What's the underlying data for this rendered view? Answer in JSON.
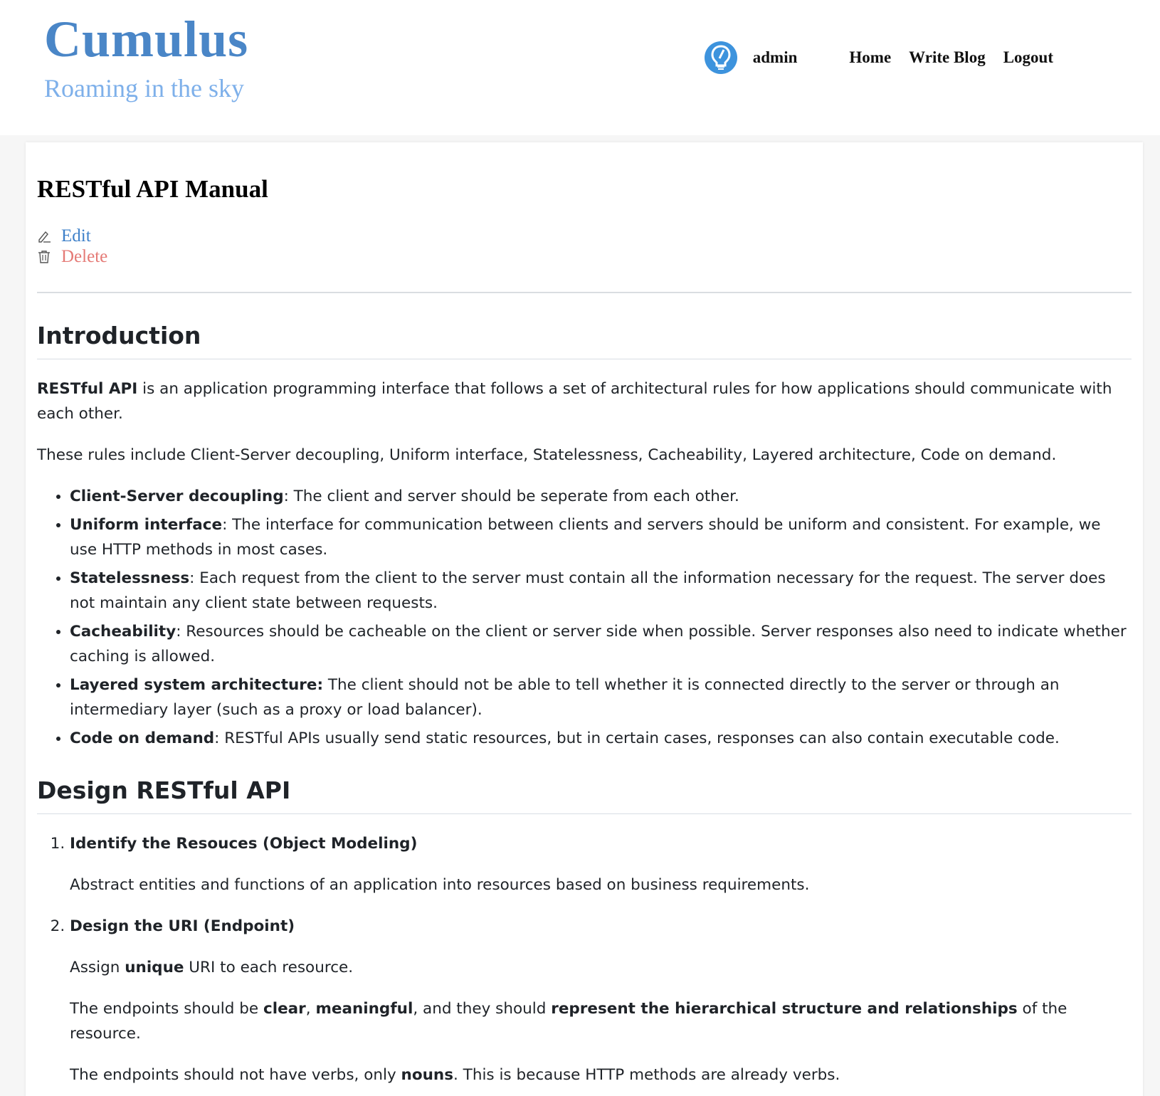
{
  "header": {
    "site_title": "Cumulus",
    "site_subtitle": "Roaming in the sky",
    "username": "admin",
    "nav": {
      "home": "Home",
      "write_blog": "Write Blog",
      "logout": "Logout"
    }
  },
  "post": {
    "title": "RESTful API Manual",
    "edit_label": "Edit",
    "delete_label": "Delete"
  },
  "intro": {
    "heading": "Introduction",
    "p1_bold": "RESTful API",
    "p1_rest": " is an application programming interface that follows a set of architectural rules for how applications should communicate with each other.",
    "p2": "These rules include Client-Server decoupling, Uniform interface, Statelessness, Cacheability, Layered architecture, Code on demand.",
    "rules": [
      {
        "term": "Client-Server decoupling",
        "desc": ": The client and server should be seperate from each other."
      },
      {
        "term": "Uniform interface",
        "desc": ": The interface for communication between clients and servers should be uniform and consistent. For example, we use HTTP methods in most cases."
      },
      {
        "term": "Statelessness",
        "desc": ": Each request from the client to the server must contain all the information necessary for the request. The server does not maintain any client state between requests."
      },
      {
        "term": "Cacheability",
        "desc": ": Resources should be cacheable on the client or server side when possible. Server responses also need to indicate whether caching is allowed."
      },
      {
        "term": "Layered system architecture:",
        "desc": " The client should not be able to tell whether it is connected directly to the server or through an intermediary layer (such as a proxy or load balancer)."
      },
      {
        "term": "Code on demand",
        "desc": ": RESTful APIs usually send static resources, but in certain cases, responses can also contain executable code."
      }
    ]
  },
  "design": {
    "heading": "Design RESTful API",
    "step1": {
      "title": "Identify the Resouces (Object Modeling)",
      "text": "Abstract entities and functions of an application into resources based on business requirements."
    },
    "step2": {
      "title": "Design the URI (Endpoint)",
      "a_pre": "Assign ",
      "a_bold": "unique",
      "a_post": " URI to each resource.",
      "b_pre": "The endpoints should be ",
      "b_bold1": "clear",
      "b_sep": ", ",
      "b_bold2": "meaningful",
      "b_mid": ", and they should ",
      "b_bold3": "represent the hierarchical structure and relationships",
      "b_post": " of the resource.",
      "c_pre": "The endpoints should not have verbs, only ",
      "c_bold": "nouns",
      "c_post": ". This is because HTTP methods are already verbs."
    }
  },
  "colors": {
    "brand": "#4a86c7",
    "subtitle": "#7eb0ea",
    "edit": "#3e80c9",
    "delete": "#e57a76",
    "avatar": "#3d93dd"
  },
  "icons": {
    "avatar": "lightbulb-avatar-icon",
    "edit": "pencil-icon",
    "delete": "trash-icon"
  }
}
